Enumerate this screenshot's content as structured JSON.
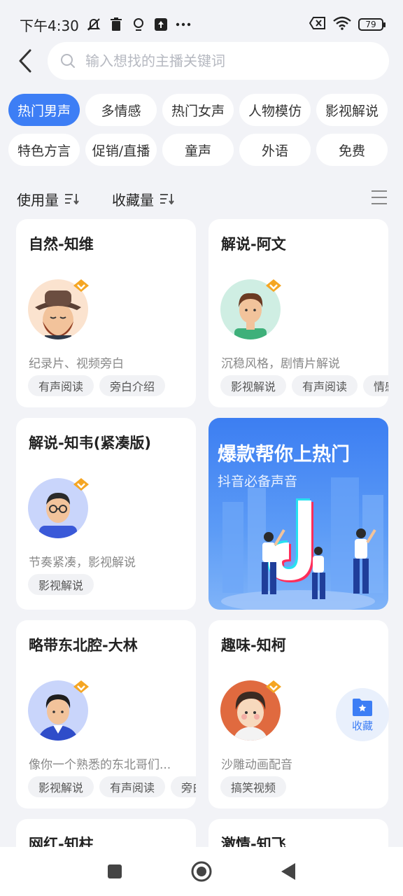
{
  "status_bar": {
    "time": "下午4:30",
    "battery": "79"
  },
  "search": {
    "placeholder": "输入想找的主播关键词"
  },
  "categories": [
    {
      "label": "热门男声",
      "active": true
    },
    {
      "label": "多情感"
    },
    {
      "label": "热门女声"
    },
    {
      "label": "人物模仿"
    },
    {
      "label": "影视解说"
    },
    {
      "label": "特色方言"
    },
    {
      "label": "促销/直播"
    },
    {
      "label": "童声"
    },
    {
      "label": "外语"
    },
    {
      "label": "免费"
    }
  ],
  "sort": {
    "usage_label": "使用量",
    "favorites_label": "收藏量"
  },
  "voices": [
    {
      "title": "自然-知维",
      "desc": "纪录片、视频旁白",
      "tags": [
        "有声阅读",
        "旁白介绍"
      ]
    },
    {
      "title": "解说-阿文",
      "desc": "沉稳风格，剧情片解说",
      "tags": [
        "影视解说",
        "有声阅读",
        "情感"
      ]
    },
    {
      "title": "解说-知韦(紧凑版)",
      "desc": "节奏紧凑，影视解说",
      "tags": [
        "影视解说"
      ]
    },
    {
      "title": "略带东北腔-大林",
      "desc": "像你一个熟悉的东北哥们...",
      "tags": [
        "影视解说",
        "有声阅读",
        "旁白"
      ]
    },
    {
      "title": "趣味-知柯",
      "desc": "沙雕动画配音",
      "tags": [
        "搞笑视频"
      ]
    },
    {
      "title": "网红-知柱",
      "desc": "",
      "tags": []
    },
    {
      "title": "激情-知飞",
      "desc": "",
      "tags": []
    }
  ],
  "promo": {
    "title": "爆款帮你上热门",
    "subtitle": "抖音必备声音"
  },
  "favorite_button": {
    "label": "收藏"
  },
  "colors": {
    "accent": "#3d7ef5",
    "background": "#f2f3f7",
    "vip_gold": "#f5a623"
  }
}
